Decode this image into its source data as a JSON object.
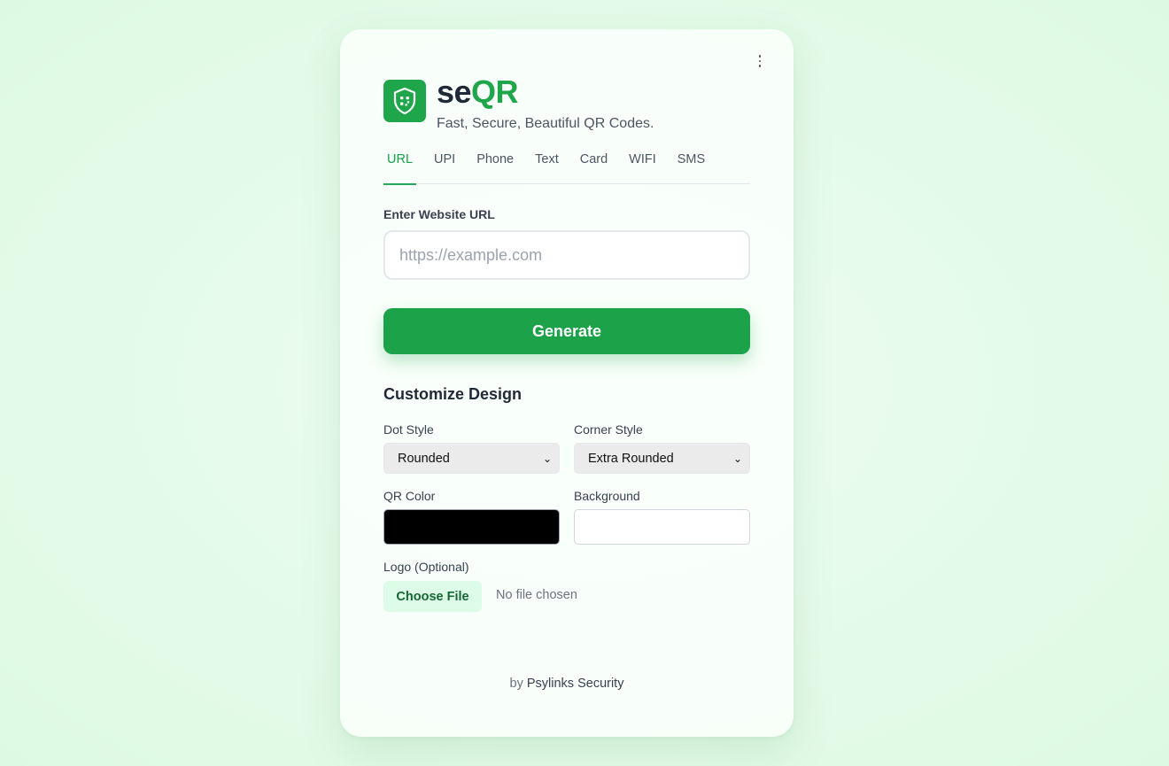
{
  "app": {
    "name_prefix": "se",
    "name_suffix": "QR",
    "tagline": "Fast, Secure, Beautiful QR Codes.",
    "logo_icon": "shield-qr-icon",
    "menu_icon": "vertical-dots-icon"
  },
  "tabs": [
    {
      "label": "URL",
      "active": true
    },
    {
      "label": "UPI",
      "active": false
    },
    {
      "label": "Phone",
      "active": false
    },
    {
      "label": "Text",
      "active": false
    },
    {
      "label": "Card",
      "active": false
    },
    {
      "label": "WIFI",
      "active": false
    },
    {
      "label": "SMS",
      "active": false
    }
  ],
  "url_form": {
    "label": "Enter Website URL",
    "value": "",
    "placeholder": "https://example.com",
    "submit_label": "Generate"
  },
  "customize": {
    "title": "Customize Design",
    "dot_style": {
      "label": "Dot Style",
      "value": "Rounded"
    },
    "corner_style": {
      "label": "Corner Style",
      "value": "Extra Rounded"
    },
    "qr_color": {
      "label": "QR Color",
      "value": "#000000"
    },
    "background": {
      "label": "Background",
      "value": "#ffffff"
    },
    "logo": {
      "label": "Logo (Optional)",
      "button_label": "Choose File",
      "status": "No file chosen"
    }
  },
  "footer": {
    "by": "by",
    "company": "Psylinks Security"
  },
  "colors": {
    "accent": "#1fa64a",
    "accent_light": "#dcfce7",
    "text_dark": "#1f2937"
  }
}
